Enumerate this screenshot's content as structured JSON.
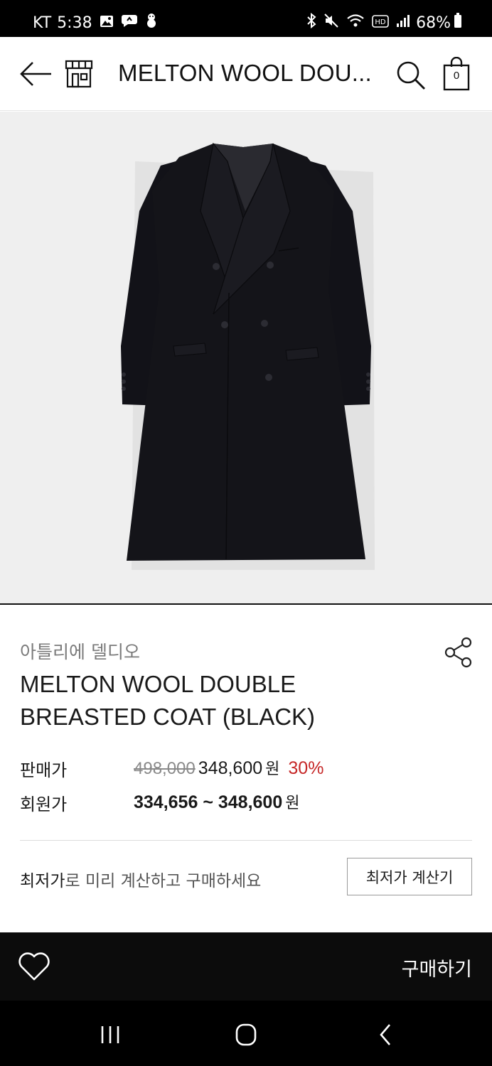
{
  "status_bar": {
    "carrier": "KT",
    "time": "5:38",
    "battery": "68%",
    "icons_left": [
      "gallery-icon",
      "chat-icon",
      "tree-icon"
    ],
    "icons_right": [
      "bluetooth-icon",
      "mute-icon",
      "wifi-icon",
      "hd-icon",
      "signal-icon",
      "battery-icon"
    ]
  },
  "header": {
    "title": "MELTON WOOL DOU...",
    "cart_count": "0",
    "icons": [
      "back-arrow-icon",
      "store-icon",
      "search-icon",
      "shopping-bag-icon"
    ]
  },
  "product": {
    "image_subject": "black double-breasted wool coat",
    "brand": "아틀리에 델디오",
    "name_line1": "MELTON WOOL DOUBLE",
    "name_line2": "BREASTED COAT (BLACK)",
    "sale_label": "판매가",
    "original_price": "498,000",
    "sale_price": "348,600",
    "currency": "원",
    "discount": "30%",
    "member_label": "회원가",
    "member_price": "334,656 ~ 348,600",
    "member_currency": "원"
  },
  "calc": {
    "text_emphasis": "최저가",
    "text_rest": "로 미리 계산하고 구매하세요",
    "button_label": "최저가 계산기"
  },
  "action_bar": {
    "buy_label": "구매하기"
  },
  "colors": {
    "discount": "#c62828",
    "action_bar_bg": "#0c0c0c",
    "image_bg": "#efefef"
  }
}
